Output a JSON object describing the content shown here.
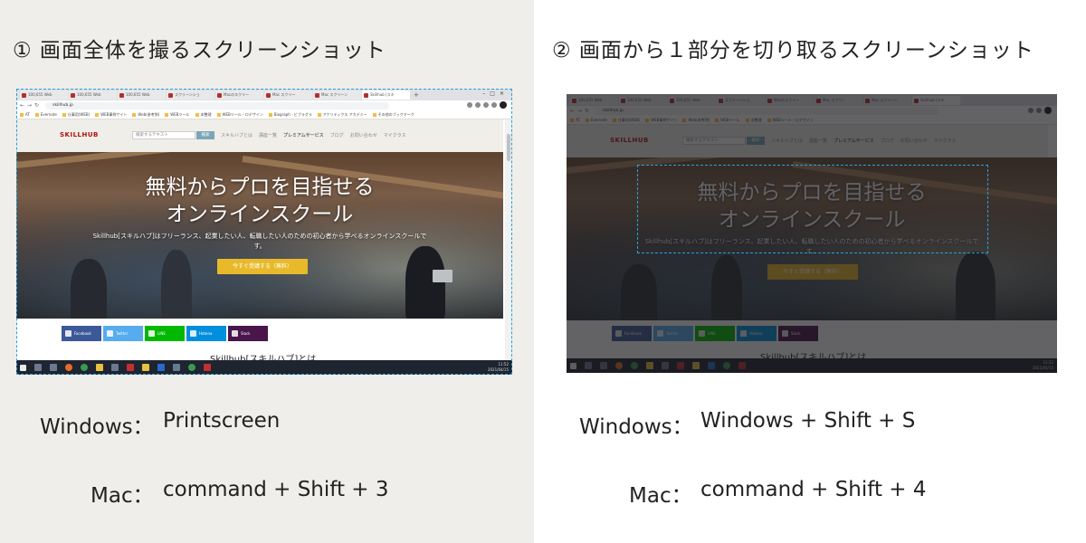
{
  "left_panel": {
    "title": "① 画面全体を撮るスクリーンショット",
    "shortcuts": [
      {
        "os": "Windows：",
        "keys": "Printscreen"
      },
      {
        "os": "Mac：",
        "keys": "command + Shift + 3"
      }
    ]
  },
  "right_panel": {
    "title": "② 画面から１部分を切り取るスクリーンショット",
    "shortcuts": [
      {
        "os": "Windows：",
        "keys": "Windows + Shift + S"
      },
      {
        "os": "Mac：",
        "keys": "command + Shift + 4"
      }
    ]
  },
  "browser": {
    "tabs": [
      "100,655 Web",
      "100,655 Web",
      "100,655 Web",
      "ズクリーンショ",
      "Macのスクリー",
      "Mac スクリー",
      "Mac スクリーン",
      "Skillhub [スキ"
    ],
    "url": "skillhub.jp",
    "bookmarks": [
      "AT",
      "Evernote",
      "仕事用(WEB)",
      "WEB事例サイト",
      "Web(参考例)",
      "WEBツール",
      "本整理",
      "WEBツール・ロデザイン",
      "Biograph - ビブラグラ",
      "アナリティクス アカデミー",
      "その他のブックマーク"
    ]
  },
  "site": {
    "logo": "SKILLHUB",
    "search_placeholder": "検索するテキスト",
    "search_button": "検索",
    "nav": [
      "スキルハブとは",
      "講座一覧",
      "プレミアムサービス",
      "ブログ",
      "お問い合わせ",
      "マイクラス"
    ],
    "hero_title_line1": "無料からプロを目指せる",
    "hero_title_line2": "オンラインスクール",
    "hero_sub": "Skillhub[スキルハブ]はフリーランス、起業したい人、転職したい人のための初心者から学べるオンラインスクールです。",
    "cta": "今すぐ受講する（無料）",
    "social": [
      "Facebook",
      "Twitter",
      "LINE",
      "Hatena",
      "Slack"
    ],
    "about_heading": "Skillhub[スキルハブ]とは",
    "clock_time": "11:52",
    "clock_date": "2021/04/15"
  },
  "colors": {
    "selection_border": "#2a9fd8",
    "cta": "#e8b92a",
    "left_bg": "#efeeea"
  }
}
